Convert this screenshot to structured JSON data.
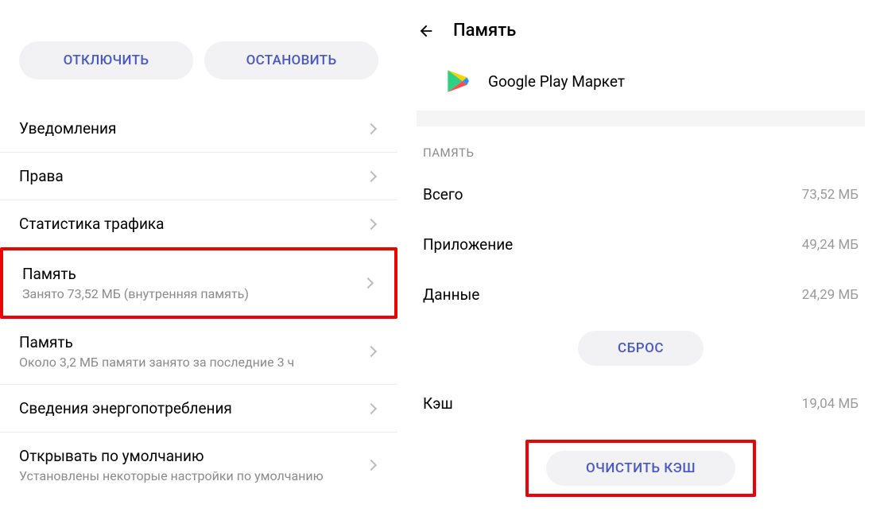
{
  "left": {
    "buttons": {
      "disable": "ОТКЛЮЧИТЬ",
      "stop": "ОСТАНОВИТЬ"
    },
    "items": [
      {
        "title": "Уведомления",
        "sub": ""
      },
      {
        "title": "Права",
        "sub": ""
      },
      {
        "title": "Статистика трафика",
        "sub": ""
      },
      {
        "title": "Память",
        "sub": "Занято 73,52 МБ (внутренняя память)"
      },
      {
        "title": "Память",
        "sub": "Около 3,2 МБ памяти занято за последние 3 ч"
      },
      {
        "title": "Сведения энергопотребления",
        "sub": ""
      },
      {
        "title": "Открывать по умолчанию",
        "sub": "Установлены некоторые настройки по умолчанию"
      }
    ]
  },
  "right": {
    "pageTitle": "Память",
    "appName": "Google Play Маркет",
    "sectionLabel": "ПАМЯТЬ",
    "rows": {
      "total": {
        "label": "Всего",
        "value": "73,52 МБ"
      },
      "app": {
        "label": "Приложение",
        "value": "49,24 МБ"
      },
      "data": {
        "label": "Данные",
        "value": "24,29 МБ"
      },
      "cache": {
        "label": "Кэш",
        "value": "19,04 МБ"
      }
    },
    "buttons": {
      "reset": "СБРОС",
      "clearCache": "ОЧИСТИТЬ КЭШ"
    }
  }
}
